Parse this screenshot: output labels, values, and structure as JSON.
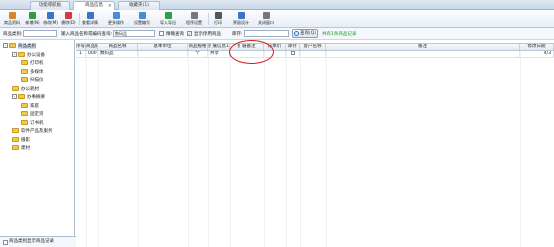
{
  "tabs": [
    {
      "label": "功能導航板",
      "active": false,
      "closable": false
    },
    {
      "label": "商品信息",
      "active": true,
      "closable": true
    },
    {
      "label": "收藏夹(1)",
      "active": false,
      "closable": false
    }
  ],
  "toolbar": [
    {
      "label": "商品资料",
      "icon": "product-icon",
      "color": "#d9822b"
    },
    {
      "label": "新增(N)",
      "icon": "add-icon",
      "color": "#2e9e3e"
    },
    {
      "label": "修改(M)",
      "icon": "edit-icon",
      "color": "#3a74c4"
    },
    {
      "label": "删除(D)",
      "icon": "delete-icon",
      "color": "#d23b3b"
    },
    {
      "label": "查看详情",
      "icon": "view-icon",
      "color": "#3a74c4"
    },
    {
      "label": "更多操作",
      "icon": "more-icon",
      "color": "#4b8bd1"
    },
    {
      "label": "设置编号",
      "icon": "number-icon",
      "color": "#4b8bd1"
    },
    {
      "label": "导入导出",
      "icon": "import-export-icon",
      "color": "#2e9e3e"
    },
    {
      "label": "程序设置",
      "icon": "settings-icon",
      "color": "#777777"
    },
    {
      "label": "打印",
      "icon": "print-icon",
      "color": "#555555"
    },
    {
      "label": "界面设计",
      "icon": "design-icon",
      "color": "#3a74c4"
    },
    {
      "label": "关闭窗口",
      "icon": "close-window-icon",
      "color": "#777777"
    }
  ],
  "filter": {
    "category_label": "商品类别:",
    "category_value": "",
    "search_label": "输入商品名称或编码查询:",
    "search_value": "数码品",
    "exact_label": "精确查询",
    "exact_checked": false,
    "show_disabled_label": "显示停用商品",
    "show_disabled_checked": true,
    "stock_label": "库存:",
    "stock_value": "",
    "query_button": "查询(Q)",
    "result_note": "共有1条商品记录"
  },
  "tree": {
    "nodes": [
      {
        "label": "商品类别",
        "level": 0,
        "expander": "-",
        "selected": true
      },
      {
        "label": "办公设备",
        "level": 1,
        "expander": "-",
        "selected": false
      },
      {
        "label": "打印机",
        "level": 2,
        "expander": "",
        "selected": false
      },
      {
        "label": "多媒体",
        "level": 2,
        "expander": "",
        "selected": false
      },
      {
        "label": "扫描仪",
        "level": 2,
        "expander": "",
        "selected": false
      },
      {
        "label": "办公耗材",
        "level": 1,
        "expander": "",
        "selected": false
      },
      {
        "label": "办事摘要",
        "level": 1,
        "expander": "-",
        "selected": false
      },
      {
        "label": "家庭",
        "level": 2,
        "expander": "",
        "selected": false
      },
      {
        "label": "固定资",
        "level": 2,
        "expander": "",
        "selected": false
      },
      {
        "label": "订书机",
        "level": 2,
        "expander": "",
        "selected": false
      },
      {
        "label": "软件产品及服务",
        "level": 1,
        "expander": "",
        "selected": false
      },
      {
        "label": "摄影",
        "level": 1,
        "expander": "",
        "selected": false
      },
      {
        "label": "建材",
        "level": 1,
        "expander": "",
        "selected": false
      }
    ],
    "footer_label": "商品类别显示商品记录"
  },
  "grid": {
    "columns": [
      "序号",
      "商品编码",
      "商品名称",
      "基本单位",
      "商品规格",
      "扩展信息1",
      "扩展备注",
      "成本价",
      "库存",
      "客户名称",
      "备注",
      "修改日期"
    ],
    "rows": [
      [
        "1",
        "0001",
        "数码品",
        "",
        "个",
        "共享",
        "",
        "",
        "",
        "",
        "",
        "4/3"
      ]
    ]
  }
}
